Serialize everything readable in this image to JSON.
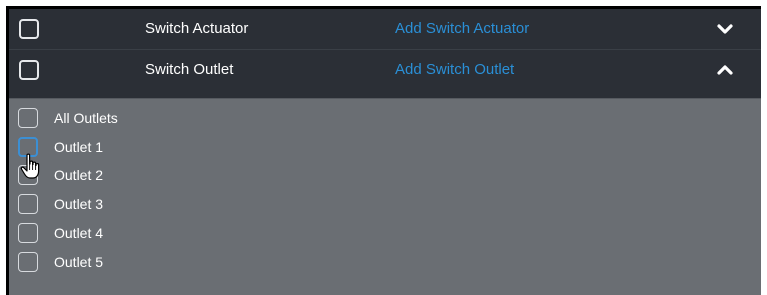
{
  "rows": [
    {
      "label": "Switch Actuator",
      "link": "Add Switch Actuator",
      "chevron": "chevron-down-icon"
    },
    {
      "label": "Switch Outlet",
      "link": "Add Switch Outlet",
      "chevron": "chevron-up-icon"
    }
  ],
  "outlets": [
    {
      "label": "All Outlets"
    },
    {
      "label": "Outlet 1"
    },
    {
      "label": "Outlet 2"
    },
    {
      "label": "Outlet 3"
    },
    {
      "label": "Outlet 4"
    },
    {
      "label": "Outlet 5"
    }
  ],
  "colors": {
    "header_bg": "#2b2f36",
    "sub_bg": "#6a6e73",
    "link": "#2a8fd6",
    "hover_border": "#3c8fd3"
  },
  "cursor": "hand-pointer-icon"
}
